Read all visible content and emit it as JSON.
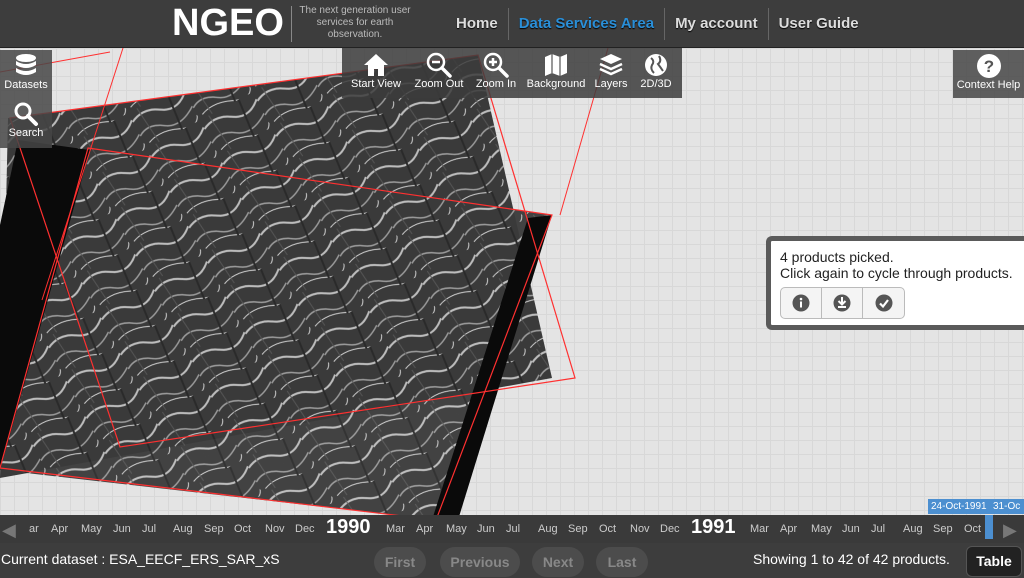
{
  "header": {
    "logo": "NGEO",
    "tagline": "The next generation user services for earth observation.",
    "nav": [
      {
        "label": "Home",
        "active": false
      },
      {
        "label": "Data Services Area",
        "active": true
      },
      {
        "label": "My account",
        "active": false
      },
      {
        "label": "User Guide",
        "active": false
      }
    ]
  },
  "left_tools": {
    "datasets": "Datasets",
    "search": "Search"
  },
  "map_toolbar": {
    "start_view": "Start View",
    "zoom_out": "Zoom Out",
    "zoom_in": "Zoom In",
    "background": "Background",
    "layers": "Layers",
    "view_mode": "2D/3D"
  },
  "context_help": "Context Help",
  "popup": {
    "line1": "4 products picked.",
    "line2": "Click again to cycle through products.",
    "buttons": [
      "info-icon",
      "download-icon",
      "check-icon"
    ]
  },
  "timeline": {
    "months_1989": [
      "ar",
      "Apr",
      "May",
      "Jun",
      "Jul",
      "Aug",
      "Sep",
      "Oct",
      "Nov",
      "Dec"
    ],
    "year1": "1990",
    "months_1990": [
      "Mar",
      "Apr",
      "May",
      "Jun",
      "Jul",
      "Aug",
      "Sep",
      "Oct",
      "Nov",
      "Dec"
    ],
    "year2": "1991",
    "months_1991": [
      "Mar",
      "Apr",
      "May",
      "Jun",
      "Jul",
      "Aug",
      "Sep",
      "Oct"
    ],
    "date_start": "24-Oct-1991",
    "date_end": "31-Oc"
  },
  "bottom": {
    "current_dataset": "Current dataset : ESA_EECF_ERS_SAR_xS",
    "first": "First",
    "previous": "Previous",
    "next": "Next",
    "last": "Last",
    "showing": "Showing 1 to 42 of 42 products.",
    "table": "Table"
  },
  "colors": {
    "accent": "#2a8fd8",
    "footprint": "#ff3030",
    "header_bg": "#3d3d3d"
  }
}
